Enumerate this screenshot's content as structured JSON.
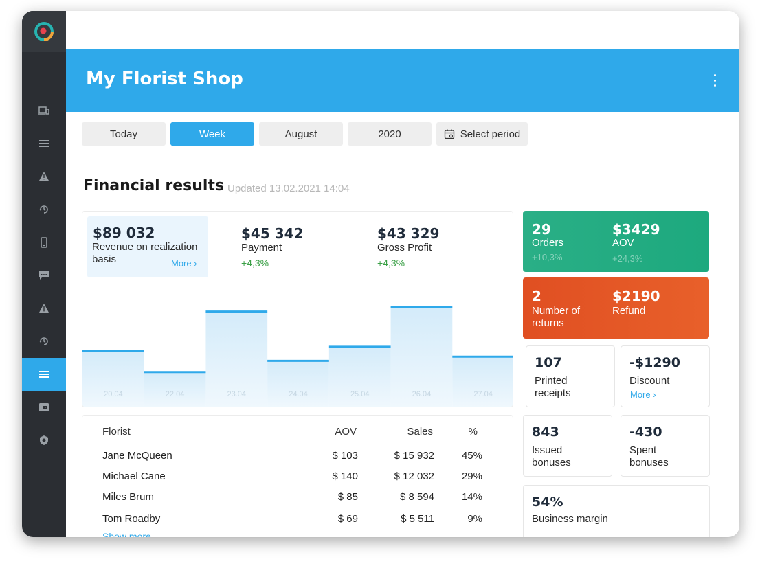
{
  "header": {
    "title": "My Florist Shop"
  },
  "tabs": [
    {
      "label": "Today"
    },
    {
      "label": "Week"
    },
    {
      "label": "August"
    },
    {
      "label": "2020"
    },
    {
      "label": "Select period"
    }
  ],
  "section": {
    "title": "Financial results",
    "updated": "Updated 13.02.2021 14:04"
  },
  "metrics": {
    "revenue": {
      "value": "$89 032",
      "label": "Revenue on realization basis",
      "more": "More ›"
    },
    "payment": {
      "value": "$45 342",
      "label": "Payment",
      "change": "+4,3%"
    },
    "profit": {
      "value": "$43 329",
      "label": "Gross Profit",
      "change": "+4,3%"
    }
  },
  "chart_data": {
    "type": "area",
    "x": [
      "20.04",
      "22.04",
      "23.04",
      "24.04",
      "25.04",
      "26.04",
      "27.04"
    ],
    "series": [
      {
        "values": [
          40,
          25,
          68,
          33,
          43,
          71,
          36
        ]
      }
    ],
    "grid": false
  },
  "table": {
    "headers": [
      "Florist",
      "AOV",
      "Sales",
      "%"
    ],
    "rows": [
      [
        "Jane McQueen",
        "$ 103",
        "$ 15 932",
        "45%"
      ],
      [
        "Michael Cane",
        "$ 140",
        "$ 12 032",
        "29%"
      ],
      [
        "Miles Brum",
        "$ 85",
        "$ 8 594",
        "14%"
      ],
      [
        "Tom Roadby",
        "$ 69",
        "$ 5 511",
        "9%"
      ]
    ],
    "show_more": "Show more"
  },
  "kpis": {
    "orders": {
      "value": "29",
      "label": "Orders",
      "change": "+10,3%"
    },
    "aov": {
      "value": "$3429",
      "label": "AOV",
      "change": "+24,3%"
    },
    "returns": {
      "value": "2",
      "label": "Number of returns"
    },
    "refund": {
      "value": "$2190",
      "label": "Refund"
    },
    "receipts": {
      "value": "107",
      "label": "Printed receipts"
    },
    "discount": {
      "value": "-$1290",
      "label": "Discount",
      "more": "More ›"
    },
    "issued": {
      "value": "843",
      "label": "Issued bonuses"
    },
    "spent": {
      "value": "-430",
      "label": "Spent bonuses"
    },
    "margin": {
      "value": "54%",
      "label": "Business margin"
    }
  },
  "colors": {
    "accent": "#2fa9ea",
    "green": "#1fa97f",
    "orange": "#e5582a",
    "sidebar": "#2b2e33"
  }
}
